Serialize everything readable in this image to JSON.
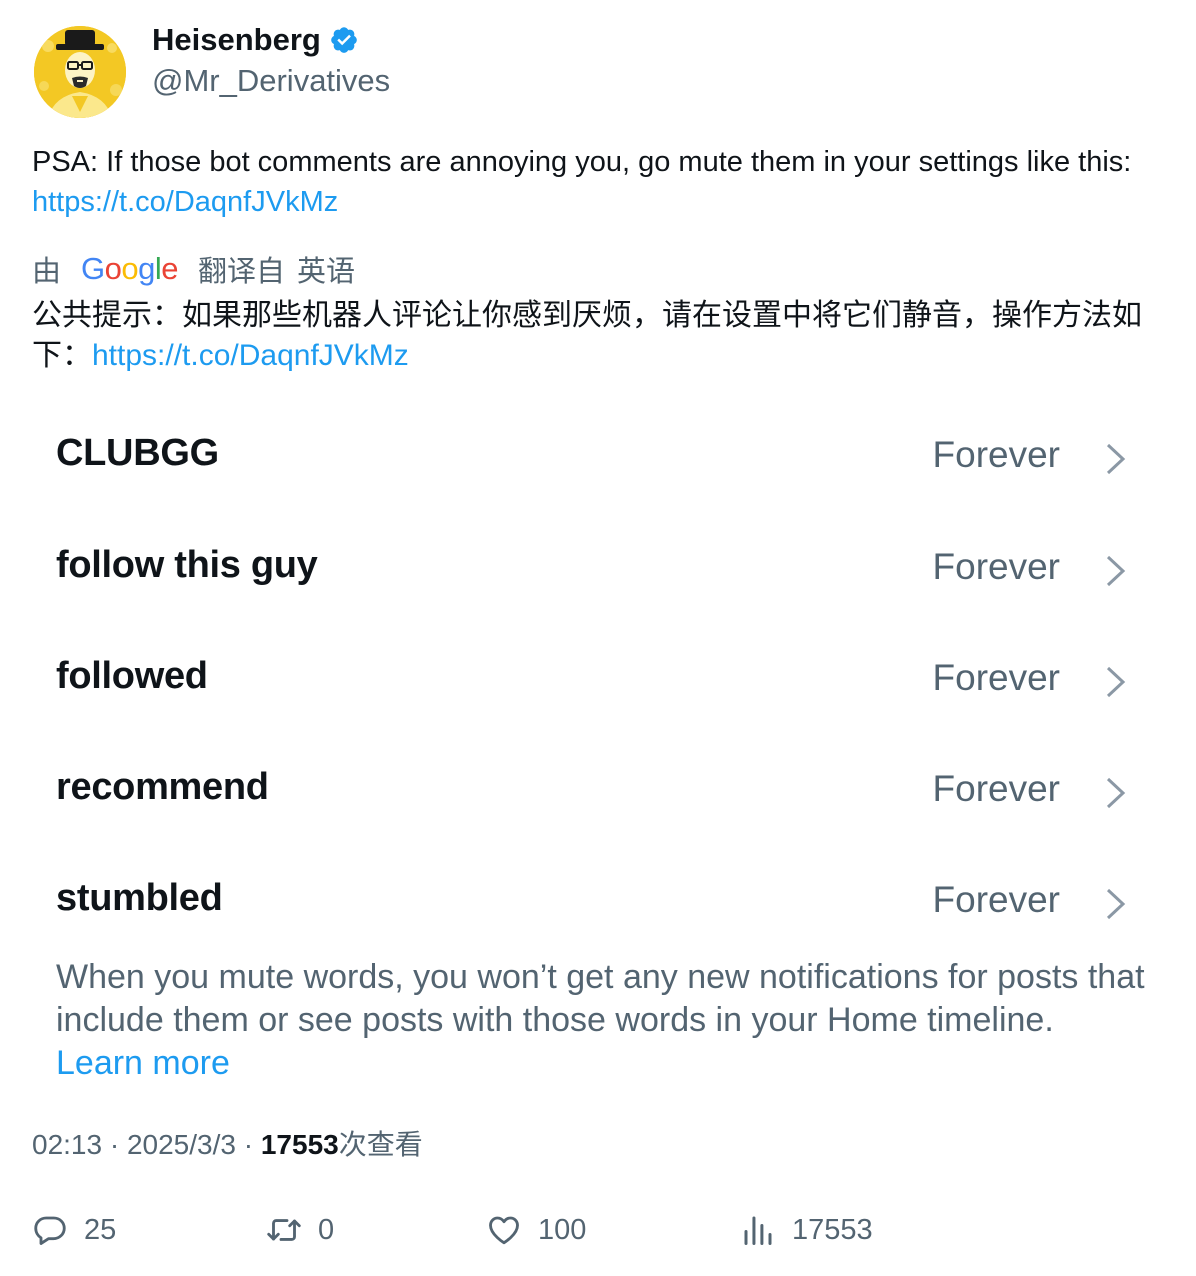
{
  "author": {
    "display_name": "Heisenberg",
    "handle": "@Mr_Derivatives",
    "verified": true,
    "avatar_icon": "heisenberg-avatar"
  },
  "tweet": {
    "text": "PSA: If those bot comments are annoying you, go mute them in your settings like this: ",
    "link": "https://t.co/DaqnfJVkMz"
  },
  "translation": {
    "by_label": "由",
    "provider": "Google",
    "translated_from_label": "翻译自",
    "language": "英语",
    "text": "公共提示：如果那些机器人评论让你感到厌烦，请在设置中将它们静音，操作方法如下：",
    "link": "https://t.co/DaqnfJVkMz"
  },
  "embedded_image": {
    "muted_words": [
      {
        "word": "CLUBGG",
        "duration": "Forever"
      },
      {
        "word": "follow this guy",
        "duration": "Forever"
      },
      {
        "word": "followed",
        "duration": "Forever"
      },
      {
        "word": "recommend",
        "duration": "Forever"
      },
      {
        "word": "stumbled",
        "duration": "Forever"
      }
    ],
    "note": "When you mute words, you won’t get any new notifications for posts that include them or see posts with those words in your Home timeline. ",
    "learn_more": "Learn more"
  },
  "meta": {
    "time": "02:13",
    "separator": " · ",
    "date": "2025/3/3",
    "views_count": "17553",
    "views_label": "次查看"
  },
  "actions": {
    "replies": "25",
    "reposts": "0",
    "likes": "100",
    "views": "17553"
  },
  "colors": {
    "text": "#0f1419",
    "secondary": "#536471",
    "link": "#1d9bf0",
    "verified": "#1d9bf0"
  }
}
